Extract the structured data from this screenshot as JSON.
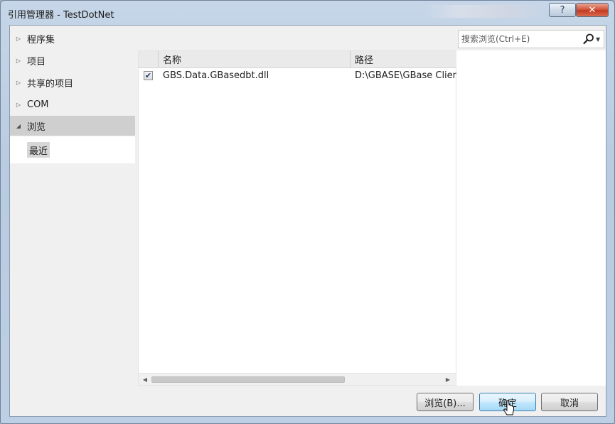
{
  "window": {
    "title": "引用管理器 - TestDotNet",
    "help_label": "?",
    "close_label": "✕"
  },
  "sidebar": {
    "items": [
      {
        "label": "程序集",
        "arrow": "▷"
      },
      {
        "label": "项目",
        "arrow": "▷"
      },
      {
        "label": "共享的项目",
        "arrow": "▷"
      },
      {
        "label": "COM",
        "arrow": "▷"
      },
      {
        "label": "浏览",
        "arrow": "◢",
        "expanded": true,
        "selected": true
      }
    ],
    "subitems": [
      {
        "label": "最近",
        "selected": true
      }
    ]
  },
  "search": {
    "placeholder": "搜索浏览(Ctrl+E)",
    "value": ""
  },
  "list": {
    "columns": [
      "名称",
      "路径"
    ],
    "rows": [
      {
        "checked": true,
        "name": "GBS.Data.GBasedbt.dll",
        "path": "D:\\GBASE\\GBase Client"
      }
    ]
  },
  "buttons": {
    "browse": "浏览(B)...",
    "ok": "确定",
    "cancel": "取消"
  },
  "colors": {
    "frame": "#b8cbe0",
    "close_button": "#c23a22",
    "selection_gray": "#cfcfcf",
    "ok_button_border": "#3c7fb1"
  }
}
